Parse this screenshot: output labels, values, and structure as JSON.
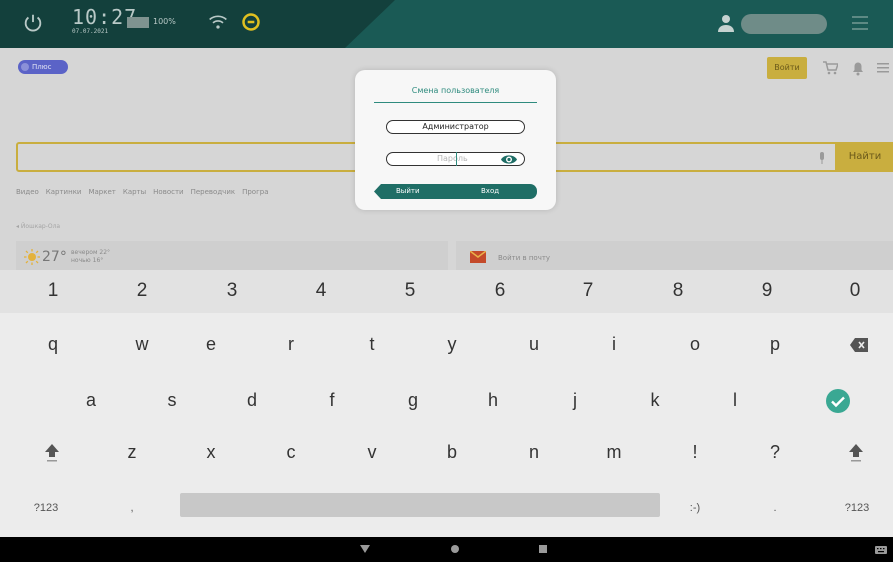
{
  "statusbar": {
    "time": "10:27",
    "date": "07.07.2021",
    "battery": "100%",
    "colors": {
      "bg": "#13403c",
      "accent": "#e0c020"
    }
  },
  "browser": {
    "logo": "Плюс",
    "login": "Войти",
    "search_button": "Найти",
    "nav": [
      "Видео",
      "Картинки",
      "Маркет",
      "Карты",
      "Новости",
      "Переводчик",
      "Програ"
    ],
    "region": "Йошкар-Ола",
    "weather": {
      "temp": "27°",
      "evening": "вечером 22°",
      "night": "ночью 16°"
    },
    "mail": "Войти в почту"
  },
  "dialog": {
    "title": "Смена пользователя",
    "username": "Администратор",
    "password_placeholder": "Пароль",
    "exit_button": "Выйти",
    "enter_button": "Вход"
  },
  "keyboard": {
    "numbers": [
      "1",
      "2",
      "3",
      "4",
      "5",
      "6",
      "7",
      "8",
      "9",
      "0"
    ],
    "row1": [
      "q",
      "w",
      "e",
      "r",
      "t",
      "y",
      "u",
      "i",
      "o",
      "p"
    ],
    "row2": [
      "a",
      "s",
      "d",
      "f",
      "g",
      "h",
      "j",
      "k",
      "l"
    ],
    "row3": [
      "z",
      "x",
      "c",
      "v",
      "b",
      "n",
      "m",
      "!",
      "?"
    ],
    "sym_left": "?123",
    "comma": ",",
    "smiley": ":-)",
    "period": ".",
    "sym_right": "?123"
  }
}
